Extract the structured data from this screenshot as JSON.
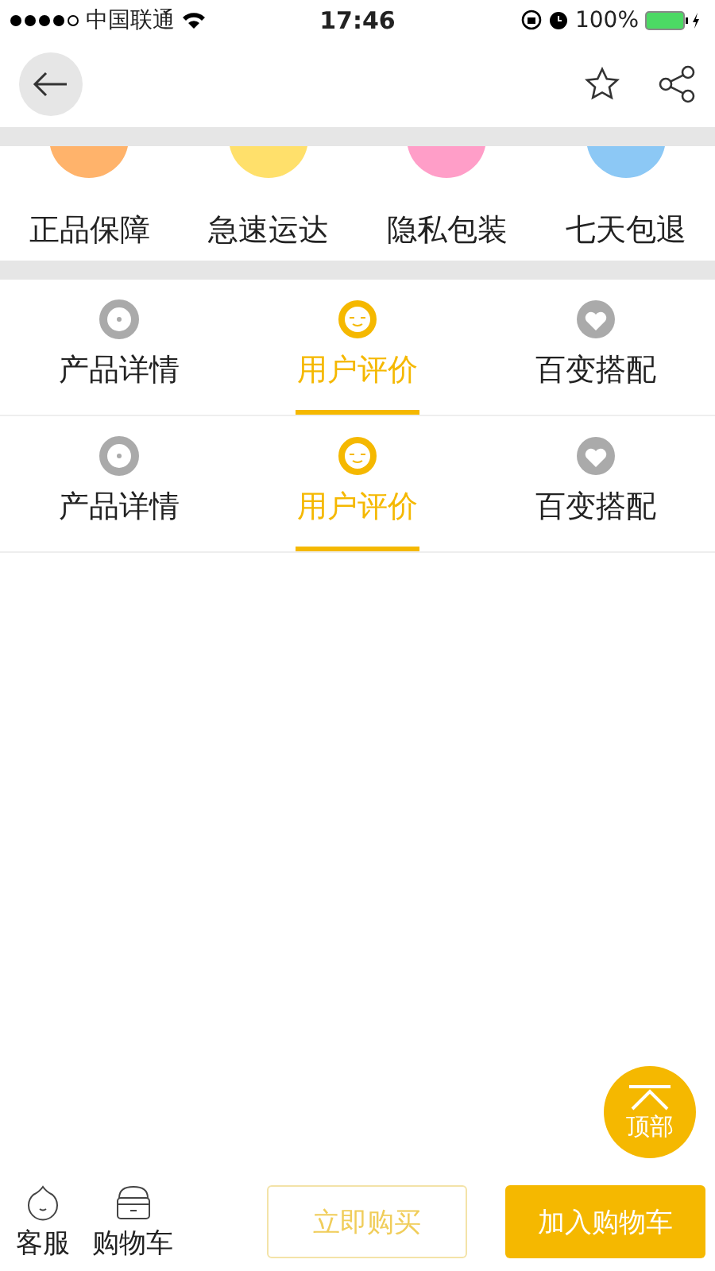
{
  "status_bar": {
    "carrier": "中国联通",
    "time": "17:46",
    "battery": "100%"
  },
  "features": [
    {
      "label": "正品保障",
      "color": "#ffb36b"
    },
    {
      "label": "急速运达",
      "color": "#ffe06b"
    },
    {
      "label": "隐私包装",
      "color": "#ff9ec8"
    },
    {
      "label": "七天包退",
      "color": "#8cc8f5"
    }
  ],
  "tab_bars": [
    {
      "tabs": [
        {
          "label": "产品详情",
          "selected": false,
          "kind": "dot"
        },
        {
          "label": "用户评价",
          "selected": true,
          "kind": "face"
        },
        {
          "label": "百变搭配",
          "selected": false,
          "kind": "heart"
        }
      ]
    },
    {
      "tabs": [
        {
          "label": "产品详情",
          "selected": false,
          "kind": "dot"
        },
        {
          "label": "用户评价",
          "selected": true,
          "kind": "face"
        },
        {
          "label": "百变搭配",
          "selected": false,
          "kind": "heart"
        }
      ]
    }
  ],
  "top_button": {
    "label": "顶部"
  },
  "bottom_bar": {
    "service": "客服",
    "cart": "购物车",
    "buy_now": "立即购买",
    "add_to_cart": "加入购物车"
  }
}
